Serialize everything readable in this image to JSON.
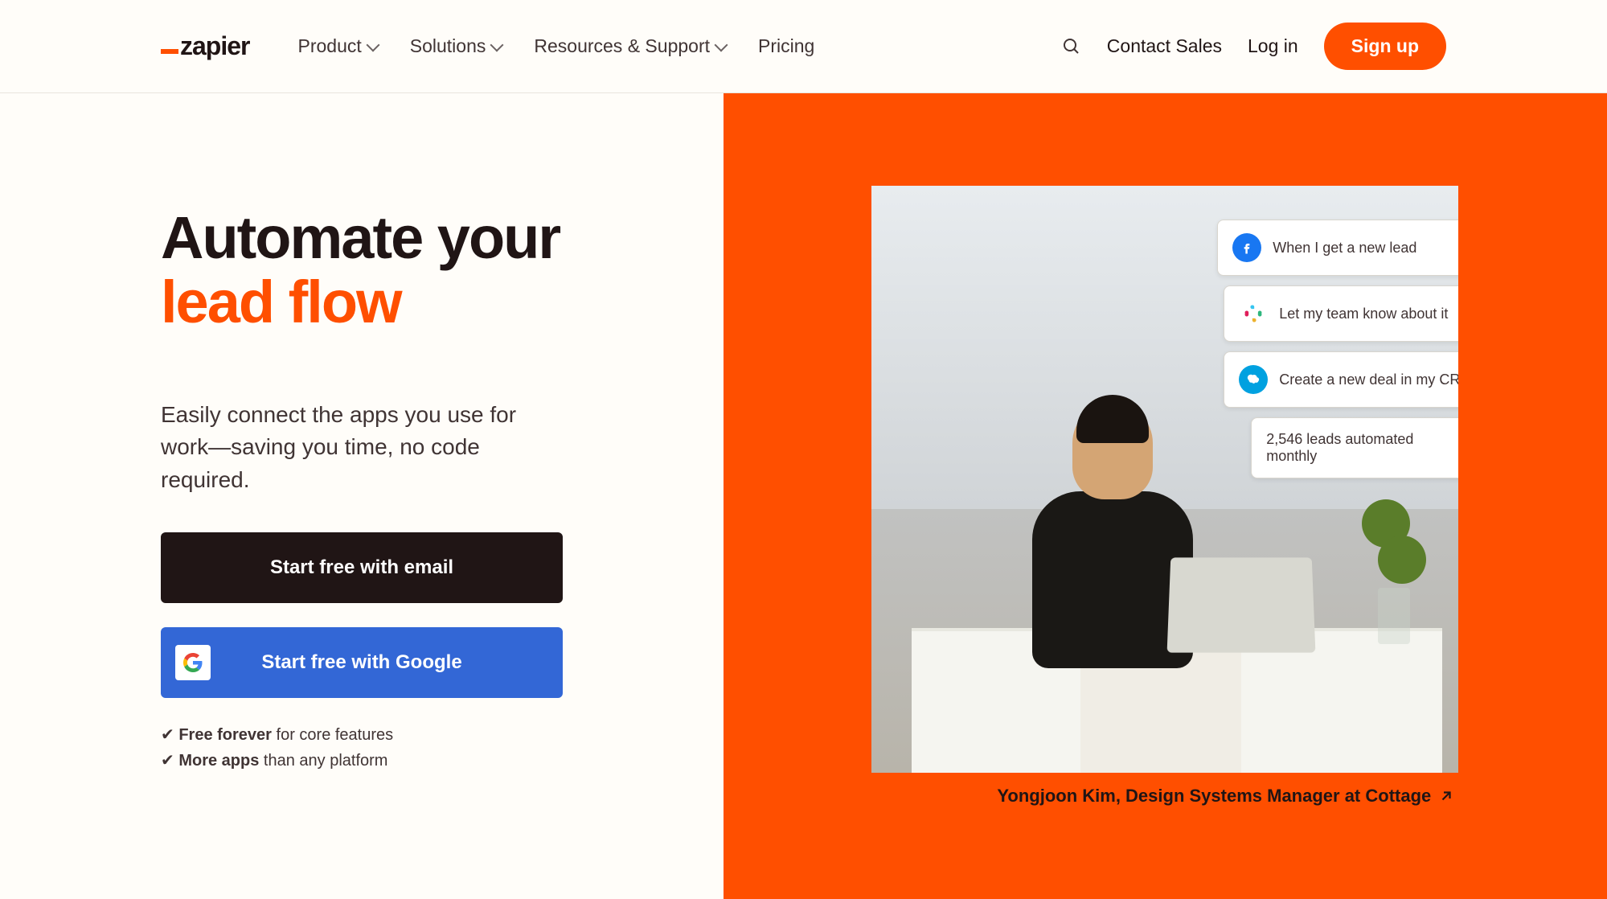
{
  "nav": {
    "logo": "zapier",
    "menu": [
      {
        "label": "Product",
        "hasDropdown": true
      },
      {
        "label": "Solutions",
        "hasDropdown": true
      },
      {
        "label": "Resources & Support",
        "hasDropdown": true
      },
      {
        "label": "Pricing",
        "hasDropdown": false
      }
    ],
    "contact": "Contact Sales",
    "login": "Log in",
    "signup": "Sign up"
  },
  "hero": {
    "headline_line1": "Automate your",
    "headline_line2": "lead flow",
    "subhead": "Easily connect the apps you use for work—saving you time, no code required.",
    "cta_email": "Start free with email",
    "cta_google": "Start free with Google",
    "benefit1_bold": "Free forever",
    "benefit1_rest": " for core features",
    "benefit2_bold": "More apps",
    "benefit2_rest": " than any platform",
    "check": "✔"
  },
  "cards": [
    {
      "icon": "facebook",
      "text": "When I get a new lead"
    },
    {
      "icon": "slack",
      "text": "Let my team know about it"
    },
    {
      "icon": "salesforce",
      "text": "Create a new deal in my CRM"
    },
    {
      "icon": "none",
      "text": "2,546 leads automated monthly"
    }
  ],
  "attribution": "Yongjoon Kim, Design Systems Manager at Cottage"
}
